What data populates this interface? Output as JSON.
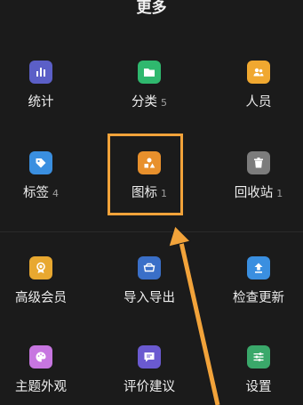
{
  "header": {
    "title": "更多"
  },
  "items": [
    {
      "label": "统计",
      "count": "",
      "color": "#5b5fc7",
      "icon": "bar-chart-icon"
    },
    {
      "label": "分类",
      "count": "5",
      "color": "#2fb86e",
      "icon": "folder-icon"
    },
    {
      "label": "人员",
      "count": "",
      "color": "#f0a830",
      "icon": "users-icon"
    },
    {
      "label": "标签",
      "count": "4",
      "color": "#3a8fe0",
      "icon": "tag-icon"
    },
    {
      "label": "图标",
      "count": "1",
      "color": "#e8902c",
      "icon": "shapes-icon"
    },
    {
      "label": "回收站",
      "count": "1",
      "color": "#7c7c7c",
      "icon": "trash-icon"
    },
    {
      "label": "高级会员",
      "count": "",
      "color": "#e8a830",
      "icon": "badge-icon"
    },
    {
      "label": "导入导出",
      "count": "",
      "color": "#3a6fc8",
      "icon": "import-export-icon"
    },
    {
      "label": "检查更新",
      "count": "",
      "color": "#3a8fe0",
      "icon": "upload-icon"
    },
    {
      "label": "主题外观",
      "count": "",
      "color": "#c776e0",
      "icon": "palette-icon"
    },
    {
      "label": "评价建议",
      "count": "",
      "color": "#6a5ad0",
      "icon": "chat-icon"
    },
    {
      "label": "设置",
      "count": "",
      "color": "#3aa86a",
      "icon": "sliders-icon"
    }
  ],
  "annotation": {
    "color": "#f2a33a"
  }
}
